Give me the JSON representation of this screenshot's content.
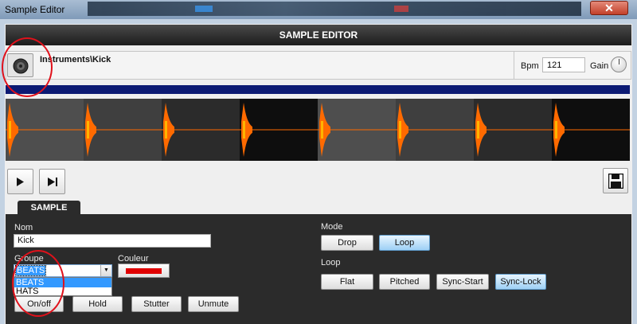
{
  "window": {
    "title": "Sample Editor",
    "close_label": "✕"
  },
  "header": {
    "title": "SAMPLE EDITOR"
  },
  "instrument": {
    "path": "Instruments\\Kick",
    "bpm_label": "Bpm",
    "bpm_value": "121",
    "gain_label": "Gain"
  },
  "icons": {
    "instrument": "drum-icon",
    "play": "play-icon",
    "next": "skip-next-icon",
    "save": "save-icon",
    "gain": "knob-icon"
  },
  "colors": {
    "waveform": "#ff6a00",
    "position_bar": "#0c1a73",
    "sample_color": "#e00000",
    "active_button": "#9ed0f5"
  },
  "waveform": {
    "beat_count": 8
  },
  "tabs": {
    "sample": "SAMPLE"
  },
  "sample": {
    "name_label": "Nom",
    "name_value": "Kick",
    "group_label": "Groupe",
    "group_value": "BEATS",
    "group_options": [
      "BEATS",
      "HATS"
    ],
    "color_label": "Couleur",
    "buttons": {
      "onoff": "On/off",
      "hold": "Hold",
      "stutter": "Stutter",
      "unmute": "Unmute"
    }
  },
  "mode": {
    "label": "Mode",
    "options": [
      "Drop",
      "Loop"
    ],
    "selected": "Loop"
  },
  "loop": {
    "label": "Loop",
    "options": [
      "Flat",
      "Pitched",
      "Sync-Start",
      "Sync-Lock"
    ],
    "selected": "Sync-Lock"
  }
}
